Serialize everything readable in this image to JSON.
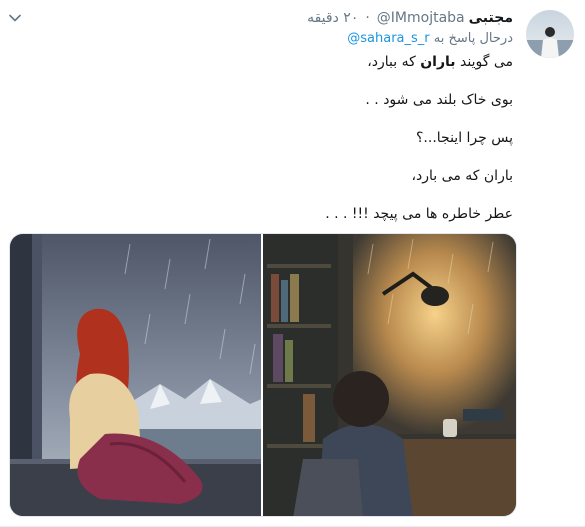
{
  "author": {
    "display_name": "مجتبی",
    "handle": "@IMmojtaba",
    "separator": "·",
    "timestamp": "۲۰ دقیقه"
  },
  "reply": {
    "prefix": "درحال پاسخ به",
    "target": "@sahara_s_r"
  },
  "body": {
    "line1_before": "می گویند ",
    "line1_bold": "باران",
    "line1_after": " که ببارد،",
    "line2": "بوی خاک بلند می شود . .",
    "line3": "پس چرا اینجا...؟",
    "line4": "باران که می بارد،",
    "line5": "عطر خاطره ها می پیچد !!! . . ."
  },
  "media": {
    "left_desc": "girl-by-rainy-window",
    "right_desc": "boy-at-desk-rain"
  },
  "colors": {
    "link": "#1b95e0",
    "muted": "#657786",
    "text": "#14171a"
  }
}
